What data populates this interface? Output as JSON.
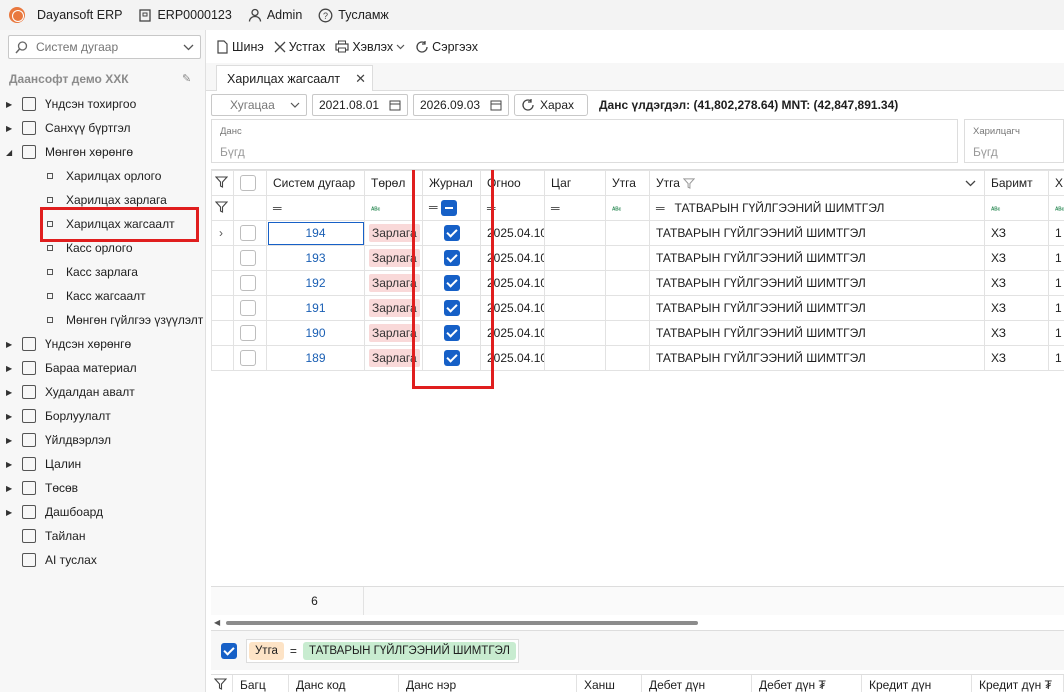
{
  "app": {
    "name": "Dayansoft ERP",
    "code": "ERP0000123",
    "user": "Admin",
    "help": "Тусламж"
  },
  "sidebar": {
    "search_placeholder": "Систем дугаар",
    "company": "Даансофт демо ХХК",
    "items": [
      {
        "label": "Үндсэн тохиргоо",
        "icon": "gear-icon",
        "arrow": true
      },
      {
        "label": "Санхүү бүртгэл",
        "icon": "ledger-icon",
        "arrow": true
      },
      {
        "label": "Мөнгөн хөрөнгө",
        "icon": "safe-icon",
        "arrow": true,
        "open": true
      },
      {
        "label": "Харилцах орлого",
        "child": true
      },
      {
        "label": "Харилцах зарлага",
        "child": true
      },
      {
        "label": "Харилцах жагсаалт",
        "child": true,
        "highlight": true
      },
      {
        "label": "Касс орлого",
        "child": true
      },
      {
        "label": "Касс зарлага",
        "child": true
      },
      {
        "label": "Касс жагсаалт",
        "child": true
      },
      {
        "label": "Мөнгөн гүйлгээ үзүүлэлт",
        "child": true
      },
      {
        "label": "Үндсэн хөрөнгө",
        "icon": "building-icon",
        "arrow": true
      },
      {
        "label": "Бараа материал",
        "icon": "box-icon",
        "arrow": true
      },
      {
        "label": "Худалдан авалт",
        "icon": "cart-icon",
        "arrow": true
      },
      {
        "label": "Борлуулалт",
        "icon": "tag-icon",
        "arrow": true
      },
      {
        "label": "Үйлдвэрлэл",
        "icon": "factory-icon",
        "arrow": true
      },
      {
        "label": "Цалин",
        "icon": "calculator-icon",
        "arrow": true
      },
      {
        "label": "Төсөв",
        "icon": "pie-icon",
        "arrow": true
      },
      {
        "label": "Дашбоард",
        "icon": "image-icon",
        "arrow": true
      },
      {
        "label": "Тайлан",
        "icon": "report-icon",
        "arrow": false
      },
      {
        "label": "AI туслах",
        "icon": "robot-icon",
        "arrow": false
      }
    ]
  },
  "toolbar": {
    "new": "Шинэ",
    "delete": "Устгах",
    "print": "Хэвлэх",
    "refresh": "Сэргээх"
  },
  "tab": {
    "title": "Харилцах жагсаалт"
  },
  "filters": {
    "period": "Хугацаа",
    "date_from": "2021.08.01",
    "date_to": "2026.09.03",
    "view": "Харах",
    "balance": "Данс үлдэгдэл: (41,802,278.64) MNT: (42,847,891.34)",
    "account_label": "Данс",
    "account_value": "Бүгд",
    "partner_label": "Харилцагч",
    "partner_value": "Бүгд"
  },
  "grid": {
    "columns": [
      "Систем дугаар",
      "Төрөл",
      "Журнал",
      "Огноо",
      "Цаг",
      "Утга",
      "Утга",
      "Баримт",
      "Х"
    ],
    "filter_value": "ТАТВАРЫН ГҮЙЛГЭЭНИЙ ШИМТГЭЛ",
    "rows": [
      {
        "no": "194",
        "type": "Зарлага",
        "date": "2025.04.10",
        "desc": "ТАТВАРЫН ГҮЙЛГЭЭНИЙ ШИМТГЭЛ",
        "doc": "ХЗ",
        "x": "1"
      },
      {
        "no": "193",
        "type": "Зарлага",
        "date": "2025.04.10",
        "desc": "ТАТВАРЫН ГҮЙЛГЭЭНИЙ ШИМТГЭЛ",
        "doc": "ХЗ",
        "x": "1"
      },
      {
        "no": "192",
        "type": "Зарлага",
        "date": "2025.04.10",
        "desc": "ТАТВАРЫН ГҮЙЛГЭЭНИЙ ШИМТГЭЛ",
        "doc": "ХЗ",
        "x": "1"
      },
      {
        "no": "191",
        "type": "Зарлага",
        "date": "2025.04.10",
        "desc": "ТАТВАРЫН ГҮЙЛГЭЭНИЙ ШИМТГЭЛ",
        "doc": "ХЗ",
        "x": "1"
      },
      {
        "no": "190",
        "type": "Зарлага",
        "date": "2025.04.10",
        "desc": "ТАТВАРЫН ГҮЙЛГЭЭНИЙ ШИМТГЭЛ",
        "doc": "ХЗ",
        "x": "1"
      },
      {
        "no": "189",
        "type": "Зарлага",
        "date": "2025.04.10",
        "desc": "ТАТВАРЫН ГҮЙЛГЭЭНИЙ ШИМТГЭЛ",
        "doc": "ХЗ",
        "x": "1"
      }
    ],
    "count": "6"
  },
  "filter_panel": {
    "field": "Утга",
    "op": "=",
    "value": "ТАТВАРЫН ГҮЙЛГЭЭНИЙ ШИМТГЭЛ"
  },
  "subgrid": {
    "columns": [
      "Багц",
      "Данс код",
      "Данс нэр",
      "Ханш",
      "Дебет дүн",
      "Дебет дүн ₮",
      "Кредит дүн",
      "Кредит дүн ₮"
    ]
  },
  "colors": {
    "accent": "#1660c7",
    "highlight": "#e01e1e",
    "tag_bg": "#f9d9d9",
    "pill_value": "#c8ecd0",
    "pill_field": "#fde3c6"
  }
}
